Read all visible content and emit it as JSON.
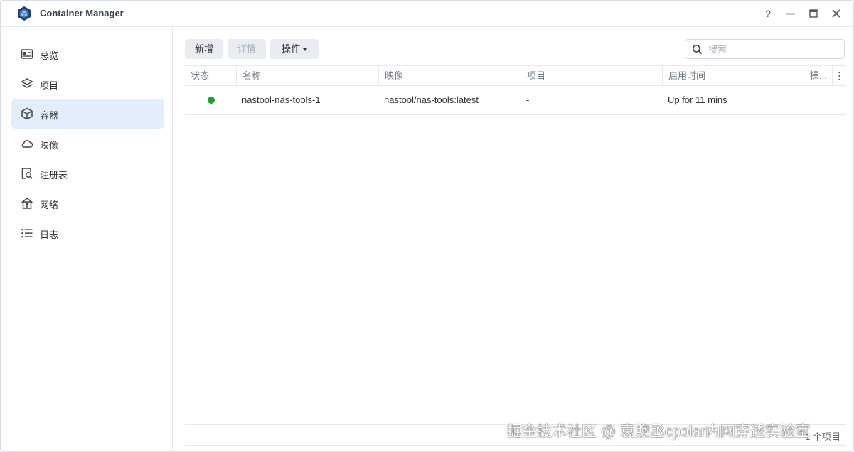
{
  "app": {
    "title": "Container Manager"
  },
  "window_controls": {
    "help": "?",
    "minimize": "—",
    "maximize": "▣",
    "close": "✕"
  },
  "sidebar": {
    "items": [
      {
        "label": "总览",
        "icon": "overview-icon",
        "active": false
      },
      {
        "label": "项目",
        "icon": "layers-icon",
        "active": false
      },
      {
        "label": "容器",
        "icon": "cube-icon",
        "active": true
      },
      {
        "label": "映像",
        "icon": "cloud-icon",
        "active": false
      },
      {
        "label": "注册表",
        "icon": "registry-search-icon",
        "active": false
      },
      {
        "label": "网络",
        "icon": "network-home-icon",
        "active": false
      },
      {
        "label": "日志",
        "icon": "list-icon",
        "active": false
      }
    ]
  },
  "toolbar": {
    "new_label": "新增",
    "details_label": "详情",
    "actions_label": "操作"
  },
  "search": {
    "placeholder": "搜索",
    "value": ""
  },
  "table": {
    "headers": [
      "状态",
      "名称",
      "映像",
      "项目",
      "启用时间",
      "操..."
    ],
    "rows": [
      {
        "status": "running",
        "name": "nastool-nas-tools-1",
        "image": "nastool/nas-tools:latest",
        "project": "-",
        "uptime": "Up for 11 mins"
      }
    ]
  },
  "footer": {
    "count_text": "1 个项目"
  },
  "watermark": "掘金技术社区 @ 袁煦丞cpolar内网穿透实验室",
  "colors": {
    "active_bg": "#e2eefb",
    "running": "#1aa130",
    "accent": "#1f6fc5"
  }
}
